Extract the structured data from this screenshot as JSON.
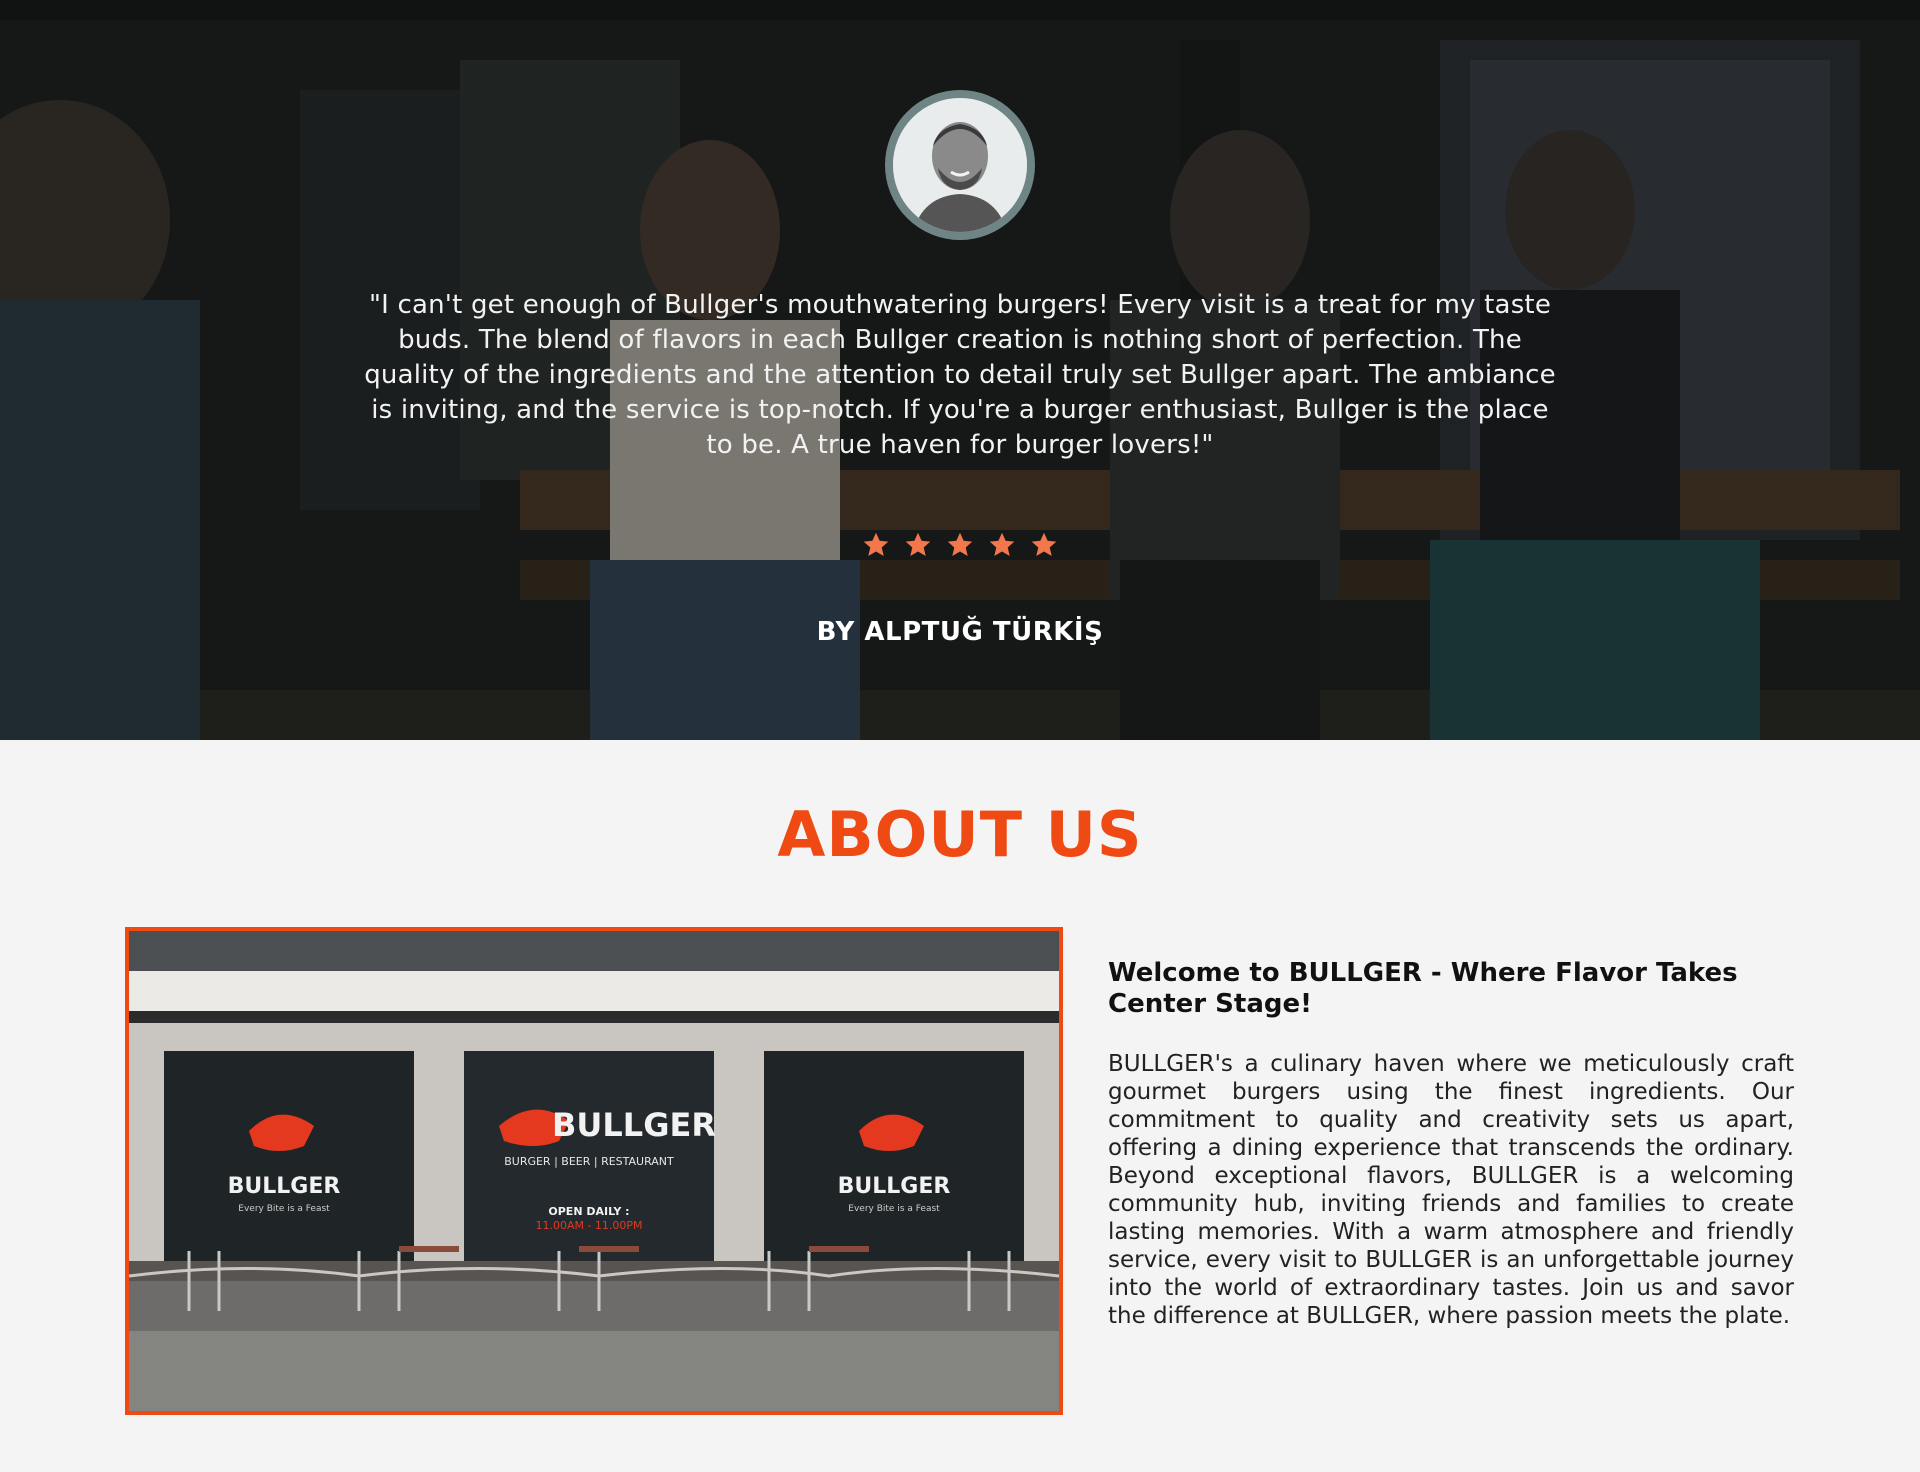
{
  "testimonial": {
    "quote": "\"I can't get enough of Bullger's mouthwatering burgers! Every visit is a treat for my taste buds. The blend of flavors in each Bullger creation is nothing short of perfection. The quality of the ingredients and the attention to detail truly set Bullger apart. The ambiance is inviting, and the service is top-notch. If you're a burger enthusiast, Bullger is the place to be. A true haven for burger lovers!\"",
    "rating": 5,
    "rating_max": 5,
    "author": "BY ALPTUĞ TÜRKİŞ",
    "star_color": "#f2774a"
  },
  "about": {
    "title": "ABOUT US",
    "heading": "Welcome to BULLGER - Where Flavor Takes Center Stage!",
    "body": "BULLGER's a culinary haven where we meticulously craft gourmet burgers using the finest ingredients. Our commitment to quality and creativity sets us apart, offering a dining experience that transcends the ordinary. Beyond exceptional flavors, BULLGER is a welcoming community hub, inviting friends and families to create lasting memories. With a warm atmosphere and friendly service, every visit to BULLGER is an unforgettable journey into the world of extraordinary tastes. Join us and savor the difference at BULLGER, where passion meets the plate.",
    "accent_color": "#ef4a14",
    "storefront": {
      "sign_left": "BULLGER",
      "sign_left_tagline": "Every Bite is a Feast",
      "sign_center": "BULLGER",
      "sign_center_sub": "BURGER | BEER | RESTAURANT",
      "sign_center_open": "OPEN DAILY :",
      "sign_center_hours": "11.00AM - 11.00PM",
      "sign_right": "BULLGER",
      "sign_right_tagline": "Every Bite is a Feast"
    }
  }
}
